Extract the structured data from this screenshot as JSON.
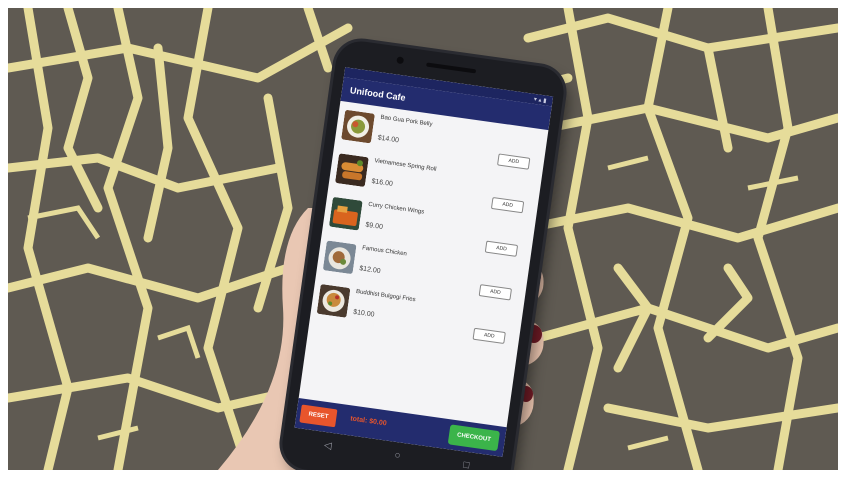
{
  "app": {
    "title": "Unifood Cafe"
  },
  "menu": {
    "items": [
      {
        "name": "Bao Gua Pork Belly",
        "price": "$14.00",
        "add_label": "ADD"
      },
      {
        "name": "Vietnamese Spring Roll",
        "price": "$16.00",
        "add_label": "ADD"
      },
      {
        "name": "Curry Chicken Wings",
        "price": "$9.00",
        "add_label": "ADD"
      },
      {
        "name": "Famous Chicken",
        "price": "$12.00",
        "add_label": "ADD"
      },
      {
        "name": "Buddhist Bulgogi Fries",
        "price": "$10.00",
        "add_label": "ADD"
      }
    ]
  },
  "footer": {
    "reset_label": "RESET",
    "total_text": "total: $0.00",
    "checkout_label": "CHECKOUT"
  },
  "colors": {
    "app_bar": "#232c6e",
    "reset": "#e8552c",
    "checkout": "#3bb44a",
    "map_lines": "#e6dc9a",
    "map_ground": "#5f5a52"
  },
  "icons": {
    "back": "back-triangle-icon",
    "home": "home-circle-icon",
    "recents": "recents-square-icon"
  }
}
